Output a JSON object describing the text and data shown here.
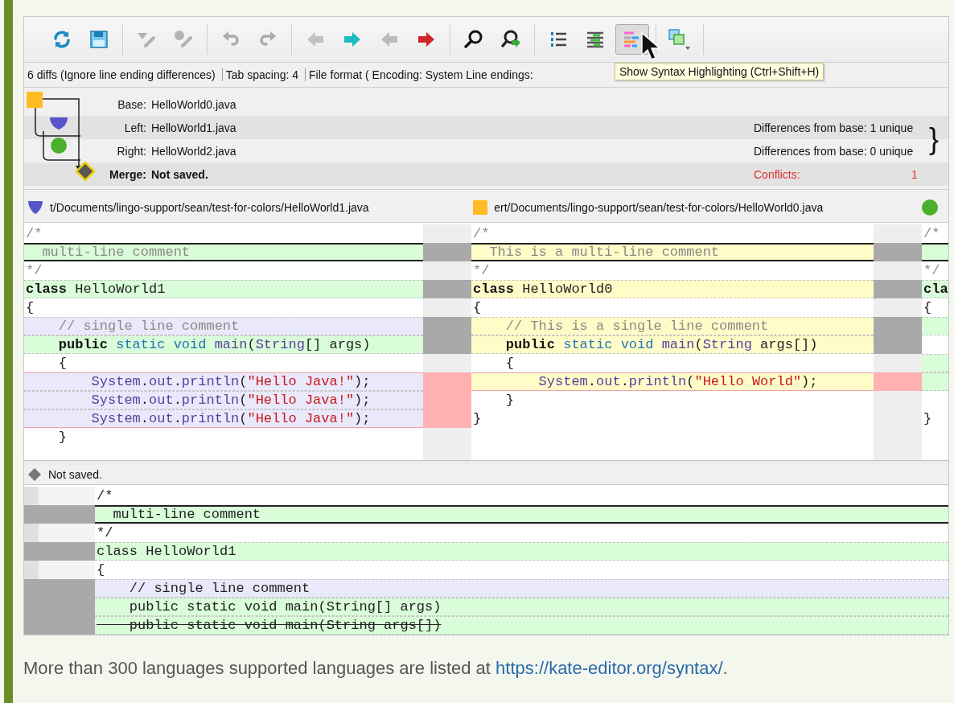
{
  "toolbar": {
    "groups": [
      [
        {
          "disabled": false,
          "pressed": false
        },
        {
          "disabled": false,
          "pressed": false
        }
      ],
      [
        {
          "disabled": true,
          "pressed": false
        },
        {
          "disabled": true,
          "pressed": false
        }
      ],
      [
        {
          "disabled": true,
          "pressed": false
        },
        {
          "disabled": true,
          "pressed": false
        }
      ],
      [
        {
          "disabled": true,
          "pressed": false
        },
        {
          "disabled": false,
          "pressed": false
        },
        {
          "disabled": true,
          "pressed": false
        },
        {
          "disabled": false,
          "pressed": false
        }
      ],
      [
        {
          "disabled": false,
          "pressed": false
        },
        {
          "disabled": false,
          "pressed": false
        }
      ],
      [
        {
          "disabled": false,
          "pressed": false
        },
        {
          "disabled": false,
          "pressed": false
        },
        {
          "disabled": false,
          "pressed": true
        }
      ],
      [
        {
          "disabled": false,
          "pressed": false
        }
      ]
    ],
    "tooltip": "Show Syntax Highlighting (Ctrl+Shift+H)"
  },
  "status_items": [
    "6 diffs (Ignore line ending differences)",
    "Tab spacing: 4",
    "File format ( Encoding: System  Line endings:"
  ],
  "files": [
    {
      "kind": "input",
      "label": "Base:",
      "name": "HelloWorld0.java"
    },
    {
      "kind": "input",
      "label": "Left:",
      "name": "HelloWorld1.java",
      "note": "Differences from base: 1 unique"
    },
    {
      "kind": "input",
      "label": "Right:",
      "name": "HelloWorld2.java",
      "note": "Differences from base: 0 unique"
    },
    {
      "kind": "merge",
      "label": "Merge:",
      "name": "Not saved.",
      "note": "Conflicts:",
      "count": "1"
    }
  ],
  "brace": "}",
  "panes": [
    {
      "kind": "shield",
      "color": "#5555c8",
      "path": "t/Documents/lingo-support/sean/test-for-colors/HelloWorld1.java",
      "lines": [
        {
          "kind": "same",
          "current": false,
          "conflict": false,
          "tokens": [
            {
              "text": "/*",
              "kind": "comment"
            }
          ]
        },
        {
          "kind": "match",
          "current": true,
          "conflict": false,
          "tokens": [
            {
              "text": "  multi-line comment",
              "kind": "comment"
            }
          ]
        },
        {
          "kind": "same",
          "current": false,
          "conflict": false,
          "tokens": [
            {
              "text": "*/",
              "kind": "comment"
            }
          ]
        },
        {
          "kind": "match",
          "current": false,
          "conflict": false,
          "tokens": [
            {
              "text": "class ",
              "kind": "keyword"
            },
            {
              "text": "HelloWorld1",
              "kind": "plain"
            }
          ]
        },
        {
          "kind": "same",
          "current": false,
          "conflict": false,
          "tokens": [
            {
              "text": "{",
              "kind": "plain"
            }
          ]
        },
        {
          "kind": "unique",
          "current": false,
          "conflict": false,
          "tokens": [
            {
              "text": "    // single line comment",
              "kind": "comment"
            }
          ]
        },
        {
          "kind": "match",
          "current": false,
          "conflict": false,
          "tokens": [
            {
              "text": "    public ",
              "kind": "keyword"
            },
            {
              "text": "static void ",
              "kind": "modifier"
            },
            {
              "text": "main",
              "kind": "name"
            },
            {
              "text": "(",
              "kind": "plain"
            },
            {
              "text": "String",
              "kind": "name"
            },
            {
              "text": "[] args)",
              "kind": "plain"
            }
          ]
        },
        {
          "kind": "same",
          "current": false,
          "conflict": false,
          "tokens": [
            {
              "text": "    {",
              "kind": "plain"
            }
          ]
        },
        {
          "kind": "unique",
          "current": false,
          "conflict": true,
          "tokens": [
            {
              "text": "        System",
              "kind": "name"
            },
            {
              "text": ".",
              "kind": "plain"
            },
            {
              "text": "out",
              "kind": "name"
            },
            {
              "text": ".",
              "kind": "plain"
            },
            {
              "text": "println",
              "kind": "name"
            },
            {
              "text": "(",
              "kind": "plain"
            },
            {
              "text": "\"Hello Java!\"",
              "kind": "string"
            },
            {
              "text": ");",
              "kind": "plain"
            }
          ]
        },
        {
          "kind": "unique",
          "current": false,
          "conflict": true,
          "tokens": [
            {
              "text": "        System",
              "kind": "name"
            },
            {
              "text": ".",
              "kind": "plain"
            },
            {
              "text": "out",
              "kind": "name"
            },
            {
              "text": ".",
              "kind": "plain"
            },
            {
              "text": "println",
              "kind": "name"
            },
            {
              "text": "(",
              "kind": "plain"
            },
            {
              "text": "\"Hello Java!\"",
              "kind": "string"
            },
            {
              "text": ");",
              "kind": "plain"
            }
          ]
        },
        {
          "kind": "unique",
          "current": false,
          "conflict": true,
          "tokens": [
            {
              "text": "        System",
              "kind": "name"
            },
            {
              "text": ".",
              "kind": "plain"
            },
            {
              "text": "out",
              "kind": "name"
            },
            {
              "text": ".",
              "kind": "plain"
            },
            {
              "text": "println",
              "kind": "name"
            },
            {
              "text": "(",
              "kind": "plain"
            },
            {
              "text": "\"Hello Java!\"",
              "kind": "string"
            },
            {
              "text": ");",
              "kind": "plain"
            }
          ]
        },
        {
          "kind": "same",
          "current": false,
          "conflict": false,
          "tokens": [
            {
              "text": "    }",
              "kind": "plain"
            }
          ]
        }
      ]
    },
    {
      "kind": "square",
      "color": "#ffbb22",
      "path": "ert/Documents/lingo-support/sean/test-for-colors/HelloWorld0.java",
      "lines": [
        {
          "kind": "same",
          "current": false,
          "conflict": false,
          "tokens": [
            {
              "text": "/*",
              "kind": "comment"
            }
          ]
        },
        {
          "kind": "base",
          "current": true,
          "conflict": false,
          "tokens": [
            {
              "text": "  This is a multi-line comment",
              "kind": "comment"
            }
          ]
        },
        {
          "kind": "same",
          "current": false,
          "conflict": false,
          "tokens": [
            {
              "text": "*/",
              "kind": "comment"
            }
          ]
        },
        {
          "kind": "base",
          "current": false,
          "conflict": false,
          "tokens": [
            {
              "text": "class ",
              "kind": "keyword"
            },
            {
              "text": "HelloWorld0",
              "kind": "plain"
            }
          ]
        },
        {
          "kind": "same",
          "current": false,
          "conflict": false,
          "tokens": [
            {
              "text": "{",
              "kind": "plain"
            }
          ]
        },
        {
          "kind": "base",
          "current": false,
          "conflict": false,
          "tokens": [
            {
              "text": "    // This is a single line comment",
              "kind": "comment"
            }
          ]
        },
        {
          "kind": "base",
          "current": false,
          "conflict": false,
          "tokens": [
            {
              "text": "    public ",
              "kind": "keyword"
            },
            {
              "text": "static void ",
              "kind": "modifier"
            },
            {
              "text": "main",
              "kind": "name"
            },
            {
              "text": "(",
              "kind": "plain"
            },
            {
              "text": "String",
              "kind": "name"
            },
            {
              "text": " args[])",
              "kind": "plain"
            }
          ]
        },
        {
          "kind": "same",
          "current": false,
          "conflict": false,
          "tokens": [
            {
              "text": "    {",
              "kind": "plain"
            }
          ]
        },
        {
          "kind": "base",
          "current": false,
          "conflict": true,
          "tokens": [
            {
              "text": "        System",
              "kind": "name"
            },
            {
              "text": ".",
              "kind": "plain"
            },
            {
              "text": "out",
              "kind": "name"
            },
            {
              "text": ".",
              "kind": "plain"
            },
            {
              "text": "println",
              "kind": "name"
            },
            {
              "text": "(",
              "kind": "plain"
            },
            {
              "text": "\"Hello World\"",
              "kind": "string"
            },
            {
              "text": ");",
              "kind": "plain"
            }
          ]
        },
        {
          "kind": "same",
          "current": false,
          "conflict": false,
          "tokens": [
            {
              "text": "    }",
              "kind": "plain"
            }
          ]
        },
        {
          "kind": "same",
          "current": false,
          "conflict": false,
          "tokens": [
            {
              "text": "}",
              "kind": "plain"
            }
          ]
        }
      ]
    },
    {
      "kind": "circle",
      "color": "#4cb02c",
      "lines": [
        {
          "kind": "same",
          "current": false,
          "conflict": false,
          "tokens": [
            {
              "text": "/*",
              "kind": "comment"
            }
          ]
        },
        {
          "kind": "match",
          "current": true,
          "conflict": false
        },
        {
          "kind": "same",
          "current": false,
          "conflict": false,
          "tokens": [
            {
              "text": "*/",
              "kind": "comment"
            }
          ]
        },
        {
          "kind": "match",
          "current": false,
          "conflict": false,
          "tokens": [
            {
              "text": "cla",
              "kind": "keyword"
            }
          ]
        },
        {
          "kind": "same",
          "current": false,
          "conflict": false,
          "tokens": [
            {
              "text": "{",
              "kind": "plain"
            }
          ]
        },
        {
          "kind": "match",
          "current": false,
          "conflict": false
        },
        {
          "kind": "same",
          "current": false,
          "conflict": false
        },
        {
          "kind": "match",
          "current": false,
          "conflict": false
        },
        {
          "kind": "match",
          "current": false,
          "conflict": false
        },
        {
          "kind": "same",
          "current": false,
          "conflict": false
        },
        {
          "kind": "same",
          "current": false,
          "conflict": false,
          "tokens": [
            {
              "text": "}",
              "kind": "plain"
            }
          ]
        }
      ]
    }
  ],
  "merge": {
    "status": "Not saved.",
    "lines": [
      {
        "kind": "same",
        "current": false,
        "struck": false,
        "text": "/*"
      },
      {
        "kind": "match",
        "current": true,
        "struck": false,
        "text": "  multi-line comment"
      },
      {
        "kind": "same",
        "current": false,
        "struck": false,
        "text": "*/"
      },
      {
        "kind": "match",
        "current": false,
        "struck": false,
        "text": "class HelloWorld1"
      },
      {
        "kind": "same",
        "current": false,
        "struck": false,
        "text": "{"
      },
      {
        "kind": "unique",
        "current": false,
        "struck": false,
        "text": "    // single line comment"
      },
      {
        "kind": "match",
        "current": false,
        "struck": false,
        "text": "    public static void main(String[] args)"
      },
      {
        "kind": "match",
        "current": false,
        "struck": true,
        "text": "    public static void main(String args[])"
      }
    ]
  },
  "footer": {
    "text": "More than 300 languages supported languages are listed at ",
    "link": "https://kate-editor.org/syntax/",
    "end": "."
  }
}
